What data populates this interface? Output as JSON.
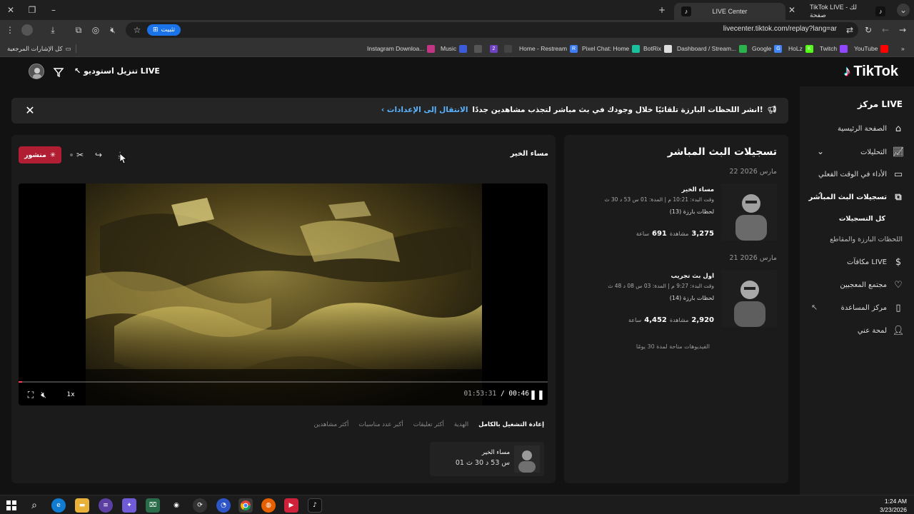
{
  "browser": {
    "tabs": [
      {
        "label": "LIVE Center",
        "active": true
      },
      {
        "label": "TikTok LIVE لك - صفحة",
        "active": false
      }
    ],
    "new_tab": "+",
    "url": "livecenter.tiktok.com/replay?lang=ar",
    "install_label": "تثبيت",
    "bookmarks_all": "كل الإشارات المرجعية",
    "bookmarks": [
      {
        "label": "Instagram Downloa...",
        "color": "#c13584",
        "icon": "instagram-icon"
      },
      {
        "label": "Music",
        "color": "#3b5bdb",
        "icon": "music-icon"
      },
      {
        "label": "",
        "color": "#555",
        "icon": "openai-icon"
      },
      {
        "label": "",
        "color": "#6f42c1",
        "icon": "badge-2-icon",
        "glyph": "2"
      },
      {
        "label": "",
        "color": "#444",
        "icon": "face-icon"
      },
      {
        "label": "Home - Restream",
        "color": "#3d7cf5",
        "icon": "restream-icon",
        "glyph": "R"
      },
      {
        "label": "Pixel Chat: Home",
        "color": "#18c29c",
        "icon": "pixelchat-icon"
      },
      {
        "label": "BotRix",
        "color": "#ddd",
        "icon": "botrix-icon"
      },
      {
        "label": "Dashboard / Stream...",
        "color": "#2bb24c",
        "icon": "streamelements-icon"
      },
      {
        "label": "Google",
        "color": "#4285f4",
        "icon": "google-icon",
        "glyph": "G"
      },
      {
        "label": "HoLz",
        "color": "#53fc18",
        "icon": "kick-icon",
        "glyph": "K"
      },
      {
        "label": "Twitch",
        "color": "#9146ff",
        "icon": "twitch-icon"
      },
      {
        "label": "YouTube",
        "color": "#ff0000",
        "icon": "youtube-icon"
      }
    ]
  },
  "app": {
    "logo": "TikTok",
    "studio_label": "تنزيل استوديو LIVE",
    "sidebar": {
      "title": "مركز LIVE",
      "items": [
        {
          "label": "الصفحة الرئيسية",
          "icon": "home-icon"
        },
        {
          "label": "التحليلات",
          "icon": "analytics-icon"
        },
        {
          "label": "الأداء في الوقت الفعلي",
          "icon": "realtime-icon"
        },
        {
          "label": "تسجيلات البث المباشر",
          "icon": "recordings-icon"
        },
        {
          "label": "مكافآت LIVE",
          "icon": "rewards-icon"
        },
        {
          "label": "مجتمع المعجبين",
          "icon": "fans-icon"
        },
        {
          "label": "مركز المساعدة",
          "icon": "help-icon"
        },
        {
          "label": "لمحة عني",
          "icon": "profile-icon"
        }
      ],
      "sub_items": [
        "كل التسجيلات",
        "اللحظات البارزة والمقاطع"
      ]
    },
    "banner": {
      "text": "انشر اللحظات البارزة تلقائيًا خلال وجودك في بث مباشر لتجذب مشاهدين جددًا!",
      "link": "الانتقال إلى الإعدادات"
    },
    "player": {
      "publish_label": "منشور",
      "clip_title": "مساء الخير",
      "current_time": "00:46",
      "total_time": "01:53:31",
      "speed": "1x",
      "progress": 0.007,
      "filters": [
        "إعادة التشغيل بالكامل",
        "الهدية",
        "أكثر تعليقات",
        "أكبر عدد مناسبات",
        "أكثر مشاهدين"
      ],
      "moment": {
        "title": "مساء الخير",
        "duration": "01 س 53 د 30 ث"
      }
    },
    "recordings": {
      "title": "تسجيلات البث المباشر",
      "groups": [
        {
          "date": "22 مارس 2026",
          "name": "مساء الخير",
          "meta": "وقت البدء: 10:21 م | المدة: 01 س 53 د 30 ث",
          "highlights": "لحظات بارزة (13)",
          "views": "3,275",
          "views_label": "مشاهدة",
          "watch": "691",
          "watch_label": "ساعة"
        },
        {
          "date": "21 مارس 2026",
          "name": "اول بث تجريب",
          "meta": "وقت البدء: 9:27 م | المدة: 03 س 08 د 48 ث",
          "highlights": "لحظات بارزة (14)",
          "views": "2,920",
          "views_label": "مشاهدة",
          "watch": "4,452",
          "watch_label": "ساعة"
        }
      ],
      "note": "الفيديوهات متاحة لمدة 30 يومًا"
    }
  },
  "taskbar": {
    "time": "1:24 AM",
    "date": "3/23/2026"
  }
}
